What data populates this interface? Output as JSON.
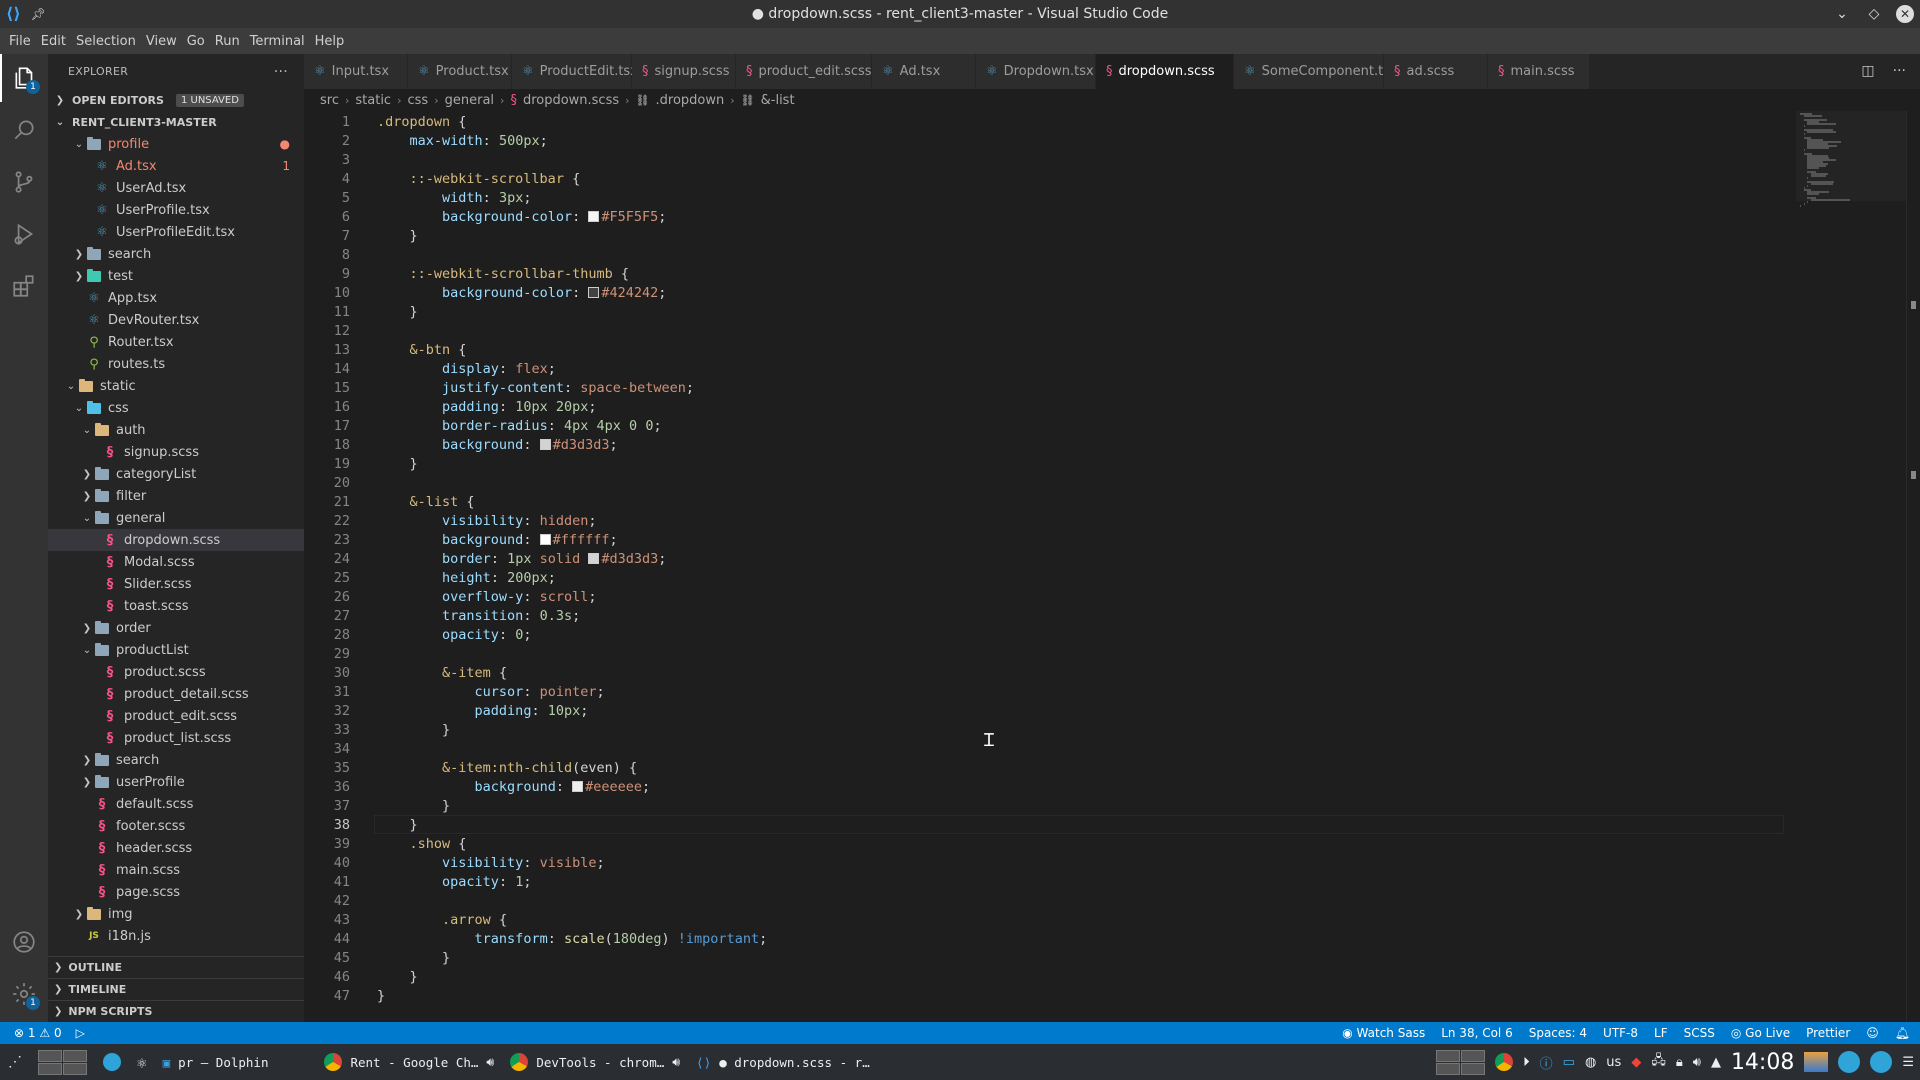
{
  "window": {
    "title": "● dropdown.scss - rent_client3-master - Visual Studio Code"
  },
  "menu": [
    "File",
    "Edit",
    "Selection",
    "View",
    "Go",
    "Run",
    "Terminal",
    "Help"
  ],
  "activity": {
    "explorer_badge": "1",
    "settings_badge": "1"
  },
  "sidebar": {
    "header": "EXPLORER",
    "open_editors": "OPEN EDITORS",
    "unsaved": "1 UNSAVED",
    "root": "RENT_CLIENT3-MASTER",
    "tree": [
      {
        "label": "profile",
        "kind": "folder-open",
        "depth": 1,
        "mod": true,
        "mark": "●"
      },
      {
        "label": "Ad.tsx",
        "kind": "react",
        "depth": 2,
        "mod": true,
        "mark": "1"
      },
      {
        "label": "UserAd.tsx",
        "kind": "react",
        "depth": 2
      },
      {
        "label": "UserProfile.tsx",
        "kind": "react",
        "depth": 2
      },
      {
        "label": "UserProfileEdit.tsx",
        "kind": "react",
        "depth": 2
      },
      {
        "label": "search",
        "kind": "folder",
        "depth": 1
      },
      {
        "label": "test",
        "kind": "folder-teal",
        "depth": 1
      },
      {
        "label": "App.tsx",
        "kind": "react",
        "depth": 1
      },
      {
        "label": "DevRouter.tsx",
        "kind": "react",
        "depth": 1
      },
      {
        "label": "Router.tsx",
        "kind": "ts",
        "depth": 1
      },
      {
        "label": "routes.ts",
        "kind": "ts",
        "depth": 1
      },
      {
        "label": "static",
        "kind": "folder-open-yellow",
        "depth": 0
      },
      {
        "label": "css",
        "kind": "folder-open-cyan",
        "depth": 1
      },
      {
        "label": "auth",
        "kind": "folder-open-yellow",
        "depth": 2
      },
      {
        "label": "signup.scss",
        "kind": "sass",
        "depth": 3
      },
      {
        "label": "categoryList",
        "kind": "folder",
        "depth": 2
      },
      {
        "label": "filter",
        "kind": "folder",
        "depth": 2
      },
      {
        "label": "general",
        "kind": "folder-open",
        "depth": 2
      },
      {
        "label": "dropdown.scss",
        "kind": "sass",
        "depth": 3,
        "selected": true
      },
      {
        "label": "Modal.scss",
        "kind": "sass",
        "depth": 3
      },
      {
        "label": "Slider.scss",
        "kind": "sass",
        "depth": 3
      },
      {
        "label": "toast.scss",
        "kind": "sass",
        "depth": 3
      },
      {
        "label": "order",
        "kind": "folder",
        "depth": 2
      },
      {
        "label": "productList",
        "kind": "folder-open",
        "depth": 2
      },
      {
        "label": "product.scss",
        "kind": "sass",
        "depth": 3
      },
      {
        "label": "product_detail.scss",
        "kind": "sass",
        "depth": 3
      },
      {
        "label": "product_edit.scss",
        "kind": "sass",
        "depth": 3
      },
      {
        "label": "product_list.scss",
        "kind": "sass",
        "depth": 3
      },
      {
        "label": "search",
        "kind": "folder",
        "depth": 2
      },
      {
        "label": "userProfile",
        "kind": "folder",
        "depth": 2
      },
      {
        "label": "default.scss",
        "kind": "sass",
        "depth": 2
      },
      {
        "label": "footer.scss",
        "kind": "sass",
        "depth": 2
      },
      {
        "label": "header.scss",
        "kind": "sass",
        "depth": 2
      },
      {
        "label": "main.scss",
        "kind": "sass",
        "depth": 2
      },
      {
        "label": "page.scss",
        "kind": "sass",
        "depth": 2
      },
      {
        "label": "img",
        "kind": "folder-img",
        "depth": 1
      },
      {
        "label": "i18n.js",
        "kind": "js",
        "depth": 1
      }
    ],
    "bottom_sections": [
      "OUTLINE",
      "TIMELINE",
      "NPM SCRIPTS"
    ]
  },
  "tabs": [
    {
      "label": "Input.tsx",
      "icon": "react"
    },
    {
      "label": "Product.tsx",
      "icon": "react"
    },
    {
      "label": "ProductEdit.tsx",
      "icon": "react"
    },
    {
      "label": "signup.scss",
      "icon": "sass"
    },
    {
      "label": "product_edit.scss",
      "icon": "sass"
    },
    {
      "label": "Ad.tsx",
      "icon": "react"
    },
    {
      "label": "Dropdown.tsx",
      "icon": "react"
    },
    {
      "label": "dropdown.scss",
      "icon": "sass",
      "active": true,
      "dirty": true
    },
    {
      "label": "SomeComponent.tsx",
      "icon": "react"
    },
    {
      "label": "ad.scss",
      "icon": "sass"
    },
    {
      "label": "main.scss",
      "icon": "sass"
    }
  ],
  "breadcrumb": [
    "src",
    "static",
    "css",
    "general",
    "dropdown.scss",
    ".dropdown",
    "&-list"
  ],
  "code_lines": [
    ".dropdown {",
    "    max-width: 500px;",
    "",
    "    ::-webkit-scrollbar {",
    "        width: 3px;",
    "        background-color: #F5F5F5;",
    "    }",
    "",
    "    ::-webkit-scrollbar-thumb {",
    "        background-color: #424242;",
    "    }",
    "",
    "    &-btn {",
    "        display: flex;",
    "        justify-content: space-between;",
    "        padding: 10px 20px;",
    "        border-radius: 4px 4px 0 0;",
    "        background: #d3d3d3;",
    "    }",
    "",
    "    &-list {",
    "        visibility: hidden;",
    "        background: #ffffff;",
    "        border: 1px solid #d3d3d3;",
    "        height: 200px;",
    "        overflow-y: scroll;",
    "        transition: 0.3s;",
    "        opacity: 0;",
    "",
    "        &-item {",
    "            cursor: pointer;",
    "            padding: 10px;",
    "        }",
    "",
    "        &-item:nth-child(even) {",
    "            background: #eeeeee;",
    "        }",
    "    }",
    "    .show {",
    "        visibility: visible;",
    "        opacity: 1;",
    "",
    "        .arrow {",
    "            transform: scale(180deg) !important;",
    "        }",
    "    }",
    "}"
  ],
  "current_line": 38,
  "status": {
    "errors": "1",
    "warnings": "0",
    "watch_sass": "Watch Sass",
    "position": "Ln 38, Col 6",
    "spaces": "Spaces: 4",
    "encoding": "UTF-8",
    "eol": "LF",
    "language": "SCSS",
    "go_live": "Go Live",
    "prettier": "Prettier"
  },
  "taskbar": {
    "tasks": [
      "pr — Dolphin",
      "Rent - Google Ch…",
      "DevTools - chrom…",
      "● dropdown.scss - r…"
    ],
    "layout": "us",
    "clock": "14:08"
  }
}
